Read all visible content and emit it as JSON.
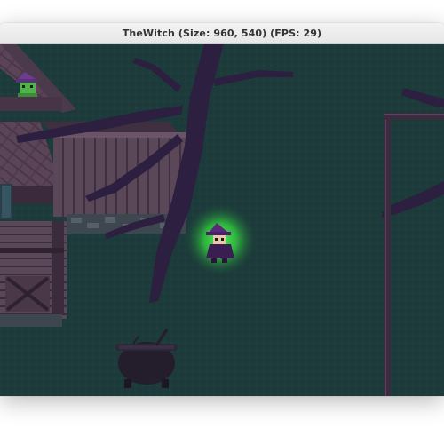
{
  "window": {
    "title": "TheWitch (Size: 960, 540) (FPS: 29)"
  },
  "game": {
    "scene": "night-forest-house",
    "colors": {
      "ground": "#1c3b3a",
      "shadow": "#2d1f3f",
      "roof": "#5c4559",
      "wood": "#4d3b4e",
      "glow": "#39e04a",
      "cauldron": "#241d2b"
    },
    "sprites": [
      "witch-player",
      "frog-witch",
      "cauldron",
      "house",
      "tree-shadow",
      "fence"
    ]
  }
}
